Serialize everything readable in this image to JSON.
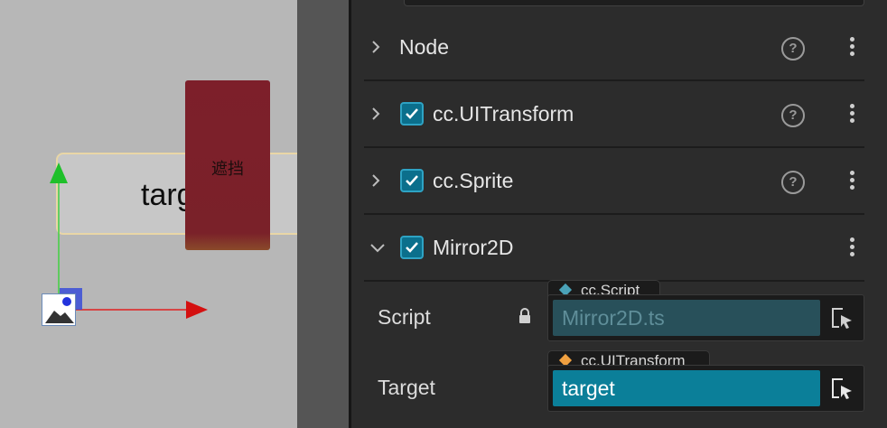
{
  "scene": {
    "target_label": "targ",
    "occluder_label": "遮挡"
  },
  "inspector": {
    "components": [
      {
        "title": "Node",
        "has_checkbox": false,
        "expanded": false,
        "has_help": true
      },
      {
        "title": "cc.UITransform",
        "has_checkbox": true,
        "checked": true,
        "expanded": false,
        "has_help": true
      },
      {
        "title": "cc.Sprite",
        "has_checkbox": true,
        "checked": true,
        "expanded": false,
        "has_help": true
      },
      {
        "title": "Mirror2D",
        "has_checkbox": true,
        "checked": true,
        "expanded": true,
        "has_help": false
      }
    ],
    "properties": {
      "script": {
        "label": "Script",
        "type_tag": "cc.Script",
        "value": "Mirror2D.ts",
        "locked": true
      },
      "target": {
        "label": "Target",
        "type_tag": "cc.UITransform",
        "value": "target"
      }
    }
  },
  "colors": {
    "scene_bg": "#b7b7b7",
    "panel_bg": "#2c2c2c",
    "checkbox_accent": "#2ea3c4",
    "script_field": "#28505a",
    "target_field": "#0b7f99",
    "occluder": "#7d1f2a",
    "script_diamond": "#4aa2b8",
    "target_diamond": "#f0a040"
  },
  "icons": [
    "chevron-right-icon",
    "chevron-down-icon",
    "checkbox-checked-icon",
    "help-icon",
    "more-vertical-icon",
    "lock-icon",
    "node-picker-icon",
    "image-sprite-icon",
    "move-gizmo"
  ]
}
